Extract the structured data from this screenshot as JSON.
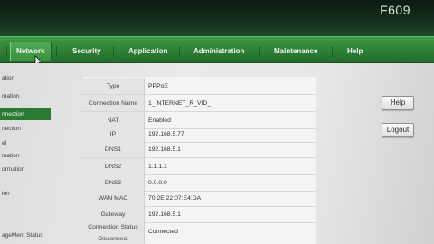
{
  "header": {
    "model": "F609"
  },
  "nav": {
    "items": [
      {
        "id": "status",
        "label": ""
      },
      {
        "id": "network",
        "label": "Network"
      },
      {
        "id": "security",
        "label": "Security"
      },
      {
        "id": "application",
        "label": "Application"
      },
      {
        "id": "administration",
        "label": "Administration"
      },
      {
        "id": "maintenance",
        "label": "Maintenance"
      },
      {
        "id": "help",
        "label": "Help"
      }
    ],
    "active": "network"
  },
  "sidebar": {
    "items": [
      {
        "label": "ation"
      },
      {
        "label": "mation"
      },
      {
        "label": "nnection"
      },
      {
        "label": "nection"
      },
      {
        "label": "el"
      },
      {
        "label": "mation"
      },
      {
        "label": "ormation"
      },
      {
        "label": "ion"
      },
      {
        "label": "ageMent Status"
      }
    ],
    "active_index": 2
  },
  "wan": {
    "rows": [
      {
        "label": "Type",
        "value": "PPPoE"
      },
      {
        "label": "Connection Name",
        "value": "1_INTERNET_R_VID_"
      },
      {
        "label": "NAT",
        "value": "Enabled"
      },
      {
        "label": "IP",
        "value": "192.168.5.77"
      },
      {
        "label": "DNS1",
        "value": "192.168.5.1"
      },
      {
        "label": "DNS2",
        "value": "1.1.1.1"
      },
      {
        "label": "DNS3",
        "value": "0.0.0.0"
      },
      {
        "label": "WAN MAC",
        "value": "70:2E:22:07:E4:DA"
      },
      {
        "label": "Gateway",
        "value": "192.168.5.1"
      },
      {
        "label": "Connection Status",
        "value": "Connected"
      }
    ],
    "truncated_label": "Disconnect"
  },
  "buttons": {
    "help": "Help",
    "logout": "Logout"
  },
  "colors": {
    "nav_green": "#2d7f35",
    "active_green": "#2a7a31"
  }
}
